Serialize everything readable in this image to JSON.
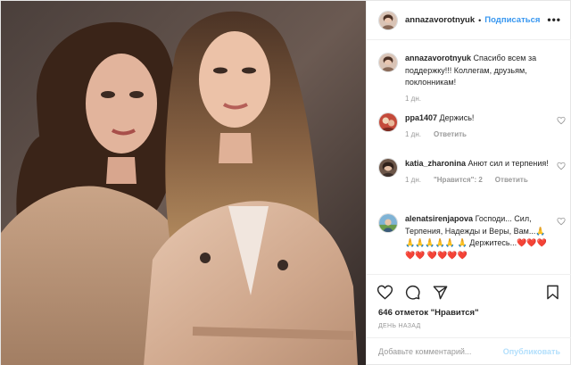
{
  "post": {
    "author": "annazavorotnyuk",
    "follow_label": "Подписаться",
    "more_label": "•••",
    "photo_description": "Two women in beige trench coats posing together"
  },
  "comments": [
    {
      "user": "annazavorotnyuk",
      "text": "Спасибо всем за поддержку!!! Коллегам, друзьям, поклонникам!",
      "time": "1 дн.",
      "likes_label": "",
      "reply_label": ""
    },
    {
      "user": "ppa1407",
      "text": "Держись!",
      "time": "1 дн.",
      "likes_label": "",
      "reply_label": "Ответить"
    },
    {
      "user": "katia_zharonina",
      "text": "Анют сил и терпения!",
      "time": "1 дн.",
      "likes_label": "\"Нравится\": 2",
      "reply_label": "Ответить"
    },
    {
      "user": "alenatsirenjapova",
      "text": "Господи... Сил, Терпения, Надежды и Веры, Вам...🙏🙏🙏🙏🙏🙏 🙏 Держитесь...❤️❤️❤️❤️❤️ ❤️❤️❤️❤️",
      "time": "",
      "likes_label": "",
      "reply_label": ""
    }
  ],
  "actions": {
    "likes_text": "646 отметок \"Нравится\"",
    "ago_text": "ДЕНЬ НАЗАД",
    "comment_placeholder": "Добавьте комментарий...",
    "publish_label": "Опубликовать"
  },
  "colors": {
    "link": "#3897f0",
    "publish_disabled": "#b2dffc",
    "muted": "#999999",
    "text": "#262626"
  }
}
